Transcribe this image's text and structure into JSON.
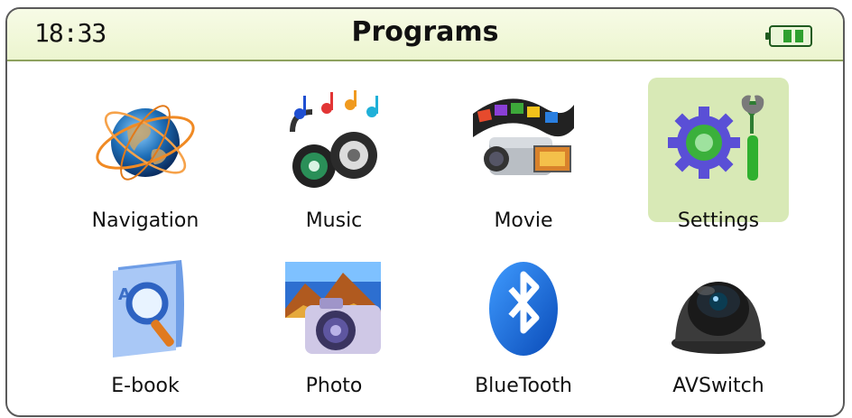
{
  "header": {
    "time": "18:33",
    "title": "Programs"
  },
  "battery": {
    "level": 1.0,
    "color": "#2fa02f"
  },
  "selected_item": "Settings",
  "programs": [
    {
      "label": "Navigation",
      "icon": "globe-orbit-icon"
    },
    {
      "label": "Music",
      "icon": "speakers-notes-icon"
    },
    {
      "label": "Movie",
      "icon": "camcorder-film-icon"
    },
    {
      "label": "Settings",
      "icon": "gear-wrench-icon"
    },
    {
      "label": "E-book",
      "icon": "book-magnifier-icon"
    },
    {
      "label": "Photo",
      "icon": "camera-photo-icon"
    },
    {
      "label": "BlueTooth",
      "icon": "bluetooth-icon"
    },
    {
      "label": "AVSwitch",
      "icon": "dome-camera-icon"
    }
  ],
  "colors": {
    "header_bg": "#ecf5cf",
    "selected_bg": "#d8e9b6",
    "frame_border": "#5a5a5a"
  }
}
